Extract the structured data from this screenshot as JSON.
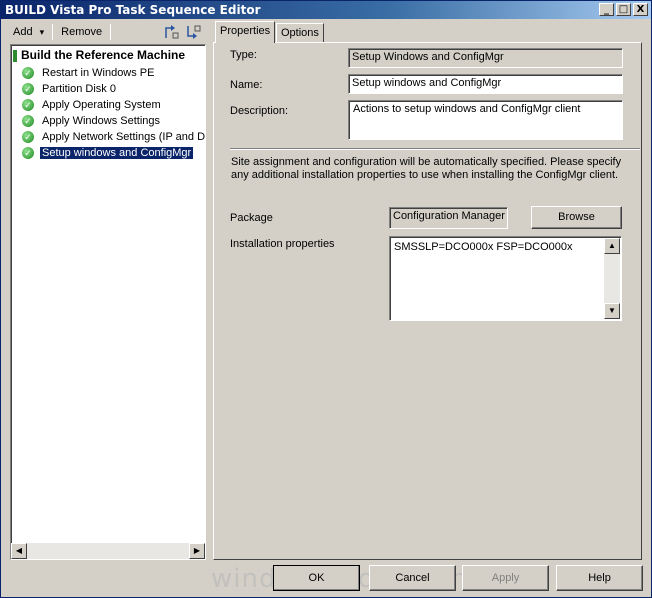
{
  "window": {
    "title": "BUILD Vista Pro Task Sequence Editor",
    "minimize": "_",
    "maximize": "□",
    "close": "X"
  },
  "toolbar": {
    "add_label": "Add",
    "add_arrow": "▾",
    "remove_label": "Remove"
  },
  "tree": {
    "root": "Build the Reference Machine",
    "items": [
      {
        "label": "Restart in Windows PE"
      },
      {
        "label": "Partition Disk 0"
      },
      {
        "label": "Apply Operating System"
      },
      {
        "label": "Apply Windows Settings"
      },
      {
        "label": "Apply Network Settings (IP and Do"
      },
      {
        "label": "Setup windows and ConfigMgr",
        "selected": true
      }
    ],
    "check_glyph": "✓"
  },
  "tabs": [
    {
      "label": "Properties",
      "active": true
    },
    {
      "label": "Options",
      "active": false
    }
  ],
  "properties": {
    "type_label": "Type:",
    "type_value": "Setup Windows and ConfigMgr",
    "name_label": "Name:",
    "name_value": "Setup windows and ConfigMgr",
    "description_label": "Description:",
    "description_value": "Actions to setup windows and ConfigMgr client",
    "info_text": "Site assignment and configuration will be automatically specified. Please specify any additional installation properties to use when installing the ConfigMgr client.",
    "package_label": "Package",
    "package_value": "Configuration Manager Client Package",
    "browse_label": "Browse",
    "install_props_label": "Installation properties",
    "install_props_value": "SMSSLP=DCO000x FSP=DCO000x"
  },
  "footer": {
    "ok_label": "OK",
    "cancel_label": "Cancel",
    "apply_label": "Apply",
    "help_label": "Help"
  },
  "watermark": "windows-noob.com",
  "colors": {
    "selection": "#0a246a",
    "check_green": "#1e8a1e",
    "titlebar_start": "#0a246a",
    "dialog_face": "#d4d0c8"
  }
}
